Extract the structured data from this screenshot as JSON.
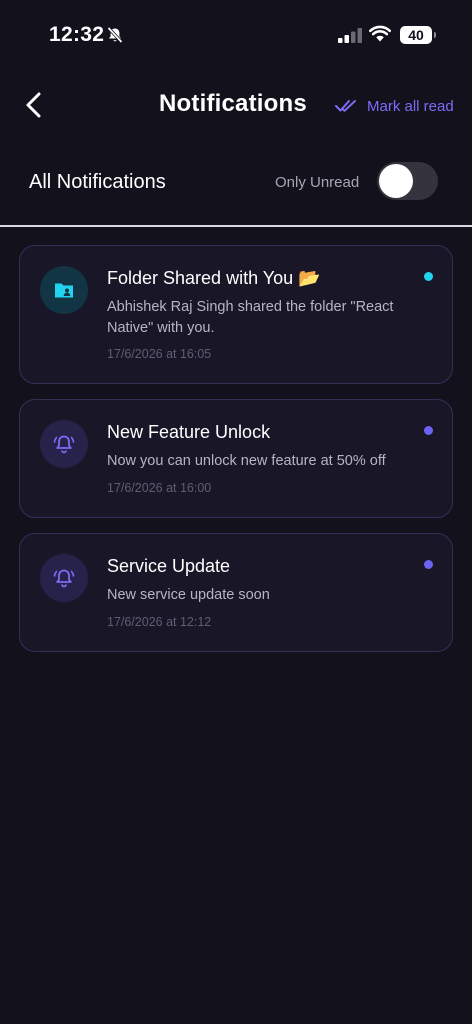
{
  "status_bar": {
    "time": "12:32",
    "battery": "40"
  },
  "header": {
    "title": "Notifications",
    "mark_all_read": "Mark all read"
  },
  "filter": {
    "title": "All Notifications",
    "only_unread_label": "Only Unread",
    "only_unread_enabled": false
  },
  "notifications": [
    {
      "title": "Folder Shared with You",
      "emoji": "📂",
      "message": "Abhishek Raj Singh shared the folder \"React Native\" with you.",
      "time": "17/6/2026 at 16:05",
      "icon": "shared-folder-icon",
      "unread": true,
      "dot_color": "#22d3ee"
    },
    {
      "title": "New Feature Unlock",
      "message": "Now you can unlock new feature at 50% off",
      "time": "17/6/2026 at 16:00",
      "icon": "bell-icon",
      "unread": true,
      "dot_color": "#6d63f2"
    },
    {
      "title": "Service Update",
      "message": "New service update soon",
      "time": "17/6/2026 at 12:12",
      "icon": "bell-icon",
      "unread": true,
      "dot_color": "#6d63f2"
    }
  ],
  "colors": {
    "background": "#13111c",
    "card_background": "#191727",
    "card_border": "#332f57",
    "accent": "#7b6cf6",
    "teal": "#22d3ee"
  }
}
